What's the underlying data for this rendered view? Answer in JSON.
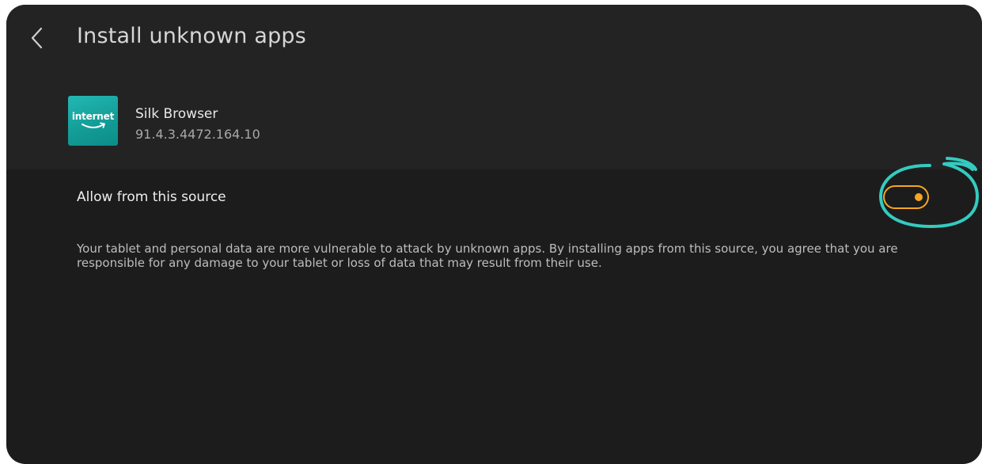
{
  "header": {
    "title": "Install unknown apps",
    "back_icon": "chevron-left-icon"
  },
  "app": {
    "icon_label": "internet",
    "name": "Silk Browser",
    "version": "91.4.3.4472.164.10"
  },
  "setting": {
    "label": "Allow from this source",
    "toggle_state": "on",
    "toggle_color": "#f5a623",
    "highlight_color": "#34cbc0"
  },
  "warning": {
    "text": "Your tablet and personal data are more vulnerable to attack by unknown apps. By installing apps from this source, you agree that you are responsible for any damage to your tablet or loss of data that may result from their use."
  },
  "colors": {
    "background": "#1c1c1c",
    "header_background": "#232323",
    "app_icon": "#1aa9a4"
  }
}
